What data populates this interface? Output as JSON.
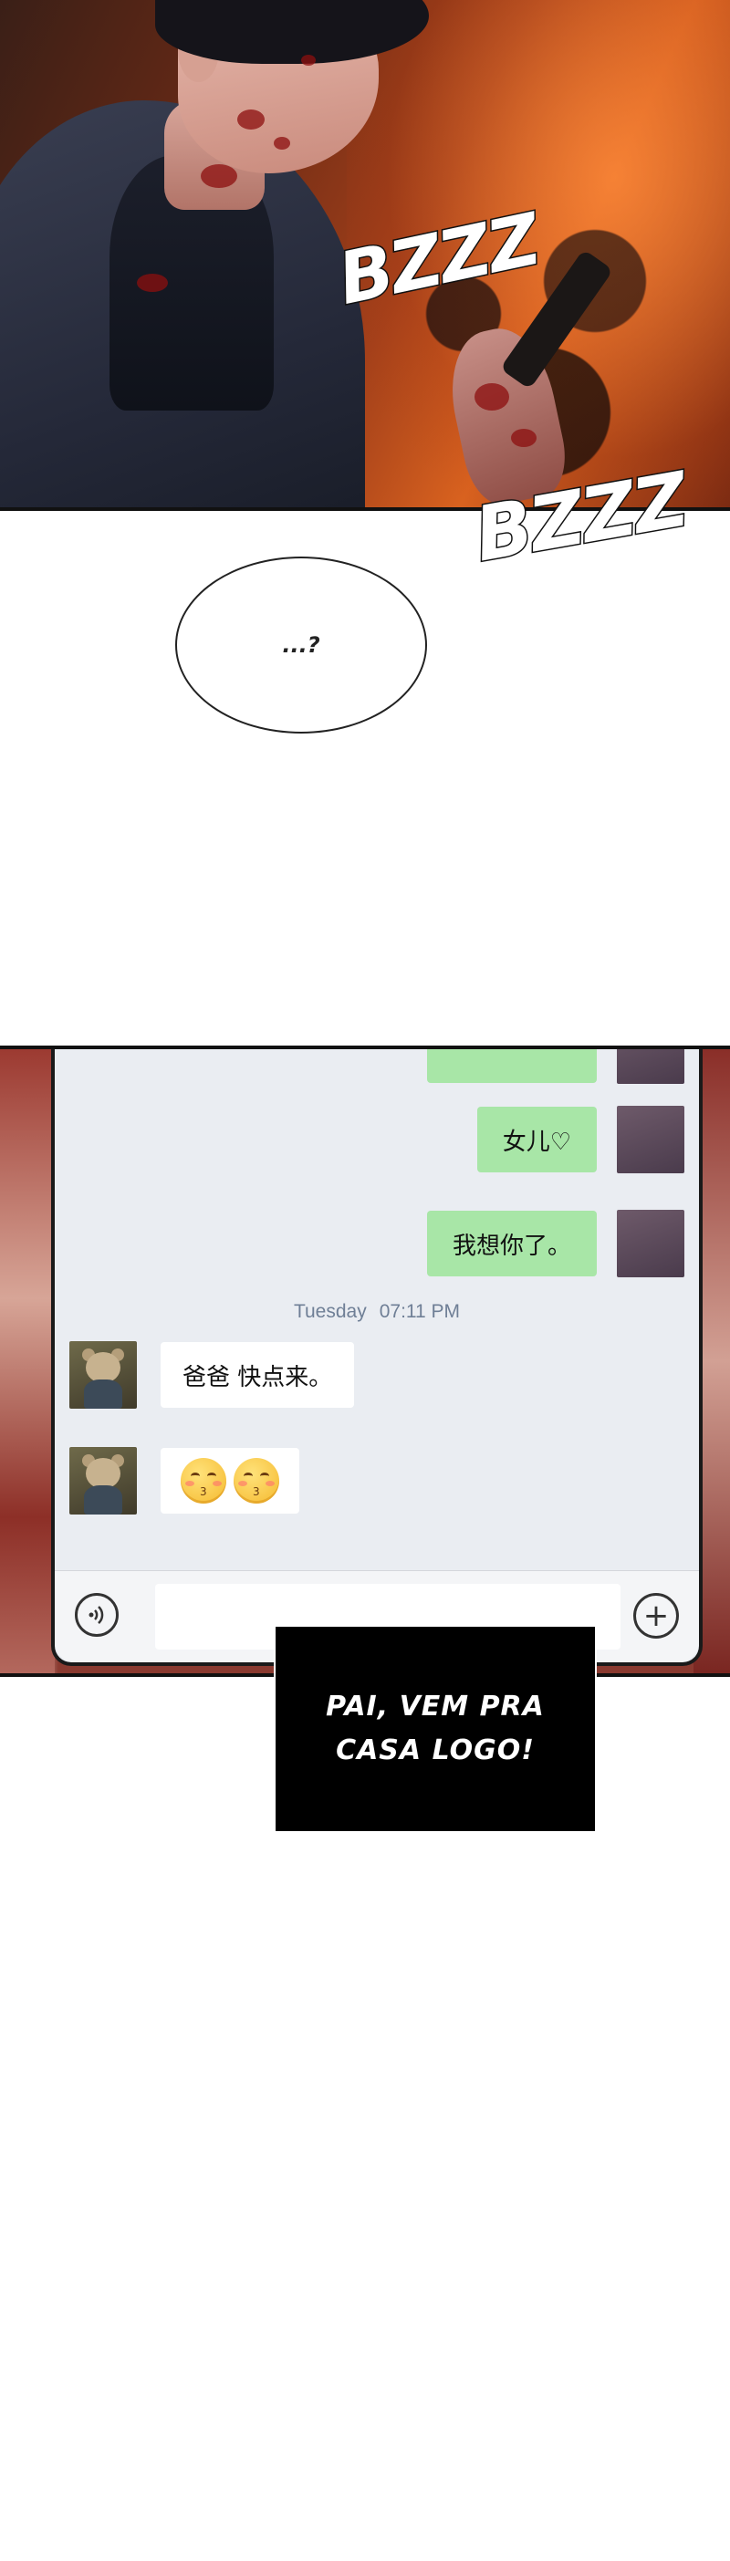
{
  "panel1": {
    "sfx_top": "BZZZ",
    "sfx_bottom": "BZZZ"
  },
  "speech_bubble": {
    "text": "...?"
  },
  "chat": {
    "messages_out": [
      {
        "text": "女儿♡"
      },
      {
        "text": "我想你了。"
      }
    ],
    "timestamp": {
      "day": "Tuesday",
      "time": "07:11 PM"
    },
    "messages_in": [
      {
        "text": "爸爸 快点来。"
      }
    ],
    "emoji_count": "2"
  },
  "caption": {
    "line1": "PAI, VEM PRA",
    "line2": "CASA LOGO!"
  },
  "colors": {
    "outgoing_bubble": "#a8e6a7",
    "incoming_bubble": "#ffffff",
    "chat_background": "#eaedf2",
    "caption_background": "#000000"
  }
}
